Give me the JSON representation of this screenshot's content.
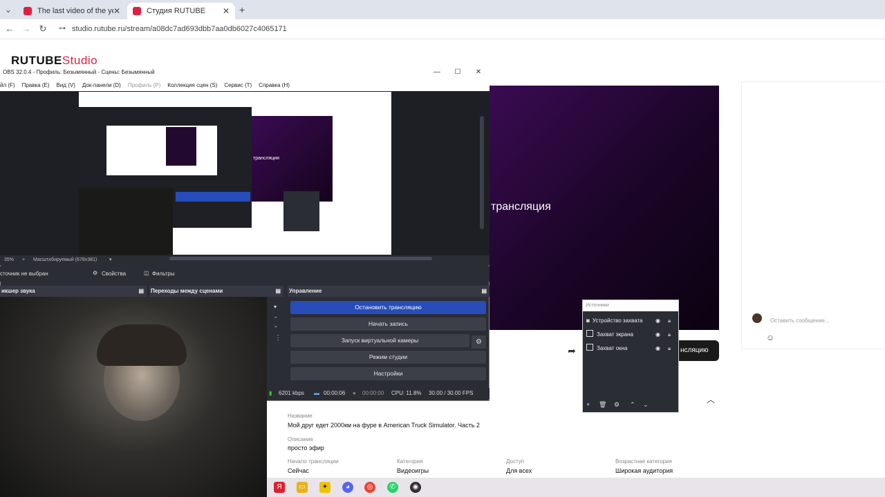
{
  "browser": {
    "tabs": [
      {
        "title": "The last video of the year | M"
      },
      {
        "title": "Студия RUTUBE"
      }
    ],
    "new_tab": "+",
    "url": "studio.rutube.ru/stream/a08dc7ad693dbb7aa0db6027c4065171"
  },
  "page": {
    "logo_main": "RUTUBE",
    "logo_sub": "Studio",
    "preview_text": "трансляция",
    "stop_button_fragment": "нсляцию",
    "chat_placeholder": "Оставить сообщение...",
    "info": {
      "name_label": "Название",
      "name_value": "Мой друг едет 2000км на фуре в American Truck Simulator. Часть 2",
      "desc_label": "Описание",
      "desc_value": "просто эфир",
      "start_label": "Начало трансляции",
      "start_value": "Сейчас",
      "category_label": "Категория",
      "category_value": "Видеоигры",
      "access_label": "Доступ",
      "access_value": "Для всех",
      "age_label": "Возрастная категория",
      "age_value": "Широкая аудитория"
    }
  },
  "obs": {
    "title": "OBS 32.0.4 - Профиль: Безымянный - Сцены: Безымянный",
    "menu": [
      "йл (F)",
      "Правка (E)",
      "Вид (V)",
      "Док-панели (D)",
      "Профиль (P)",
      "Коллекция сцен (S)",
      "Сервис (T)",
      "Справка (H)"
    ],
    "canvas_text": "трансляция",
    "zoom": "35%",
    "scale_mode": "Масштабируемый (678x381)",
    "no_source": "сточник не выбран",
    "properties": "Свойства",
    "filters": "Фильтры",
    "dock_mixer": "икшер звука",
    "dock_transitions": "Переходы между сценами",
    "dock_controls": "Управление",
    "controls": {
      "stop_stream": "Остановить трансляцию",
      "start_record": "Начать запись",
      "virtual_cam": "Запуск виртуальной камеры",
      "studio_mode": "Режим студии",
      "settings": "Настройки"
    },
    "status": {
      "bitrate": "6201 kbps",
      "stream_time": "00:00:06",
      "record_time": "00:00:00",
      "cpu": "CPU: 11.8%",
      "fps": "30.00 / 30.00 FPS"
    },
    "sources": {
      "title": "Источники",
      "items": [
        "Устройство захвата",
        "Захват экрана",
        "Захват окна"
      ]
    }
  }
}
